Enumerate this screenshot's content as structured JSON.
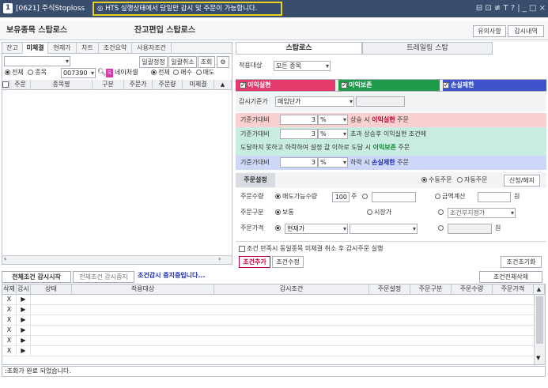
{
  "window": {
    "id_badge": "1",
    "title": "[0621] 주식Stoploss",
    "warning": "◎ HTS 실행상태에서 당일만 감시 및 주문이 가능합니다.",
    "controls": "⊟ ⊡ ≢ T ? | _ □ ×"
  },
  "header": {
    "title_left": "보유종목 스탑로스",
    "title_center": "잔고편입 스탑로스",
    "btn_caution": "유의사항",
    "btn_history": "감시내역"
  },
  "left": {
    "tabs": [
      "잔고",
      "미체결",
      "현재가",
      "차트",
      "조건요약",
      "사용자조건"
    ],
    "account_placeholder": "",
    "btn_bulk_correct": "일괄정정",
    "btn_bulk_cancel": "일괄취소",
    "btn_query": "조회",
    "radio_all": "전체",
    "radio_stock": "종목",
    "stock_code": "007390",
    "stock_name": "네이처셀",
    "radio_all2": "전체",
    "radio_buy": "매수",
    "radio_sell": "매도",
    "columns": [
      "주문",
      "종목명",
      "구분",
      "주문가",
      "주문량",
      "미체결"
    ]
  },
  "right": {
    "tab_stoploss": "스탑로스",
    "tab_trailing": "트레일링 스탑",
    "target_label": "적용대상",
    "target_value": "모든 종목",
    "chk_profit": "이익실현",
    "chk_preserve": "이익보존",
    "chk_loss": "손실제한",
    "basis_label": "감시기준가",
    "basis_value": "매입단가",
    "row1": {
      "label": "기준가대비",
      "value": "3",
      "unit": "%",
      "t1": "상승 시",
      "t2": "이익실현",
      "t3": "주문"
    },
    "row2": {
      "label": "기준가대비",
      "value": "3",
      "unit": "%",
      "t1": "초과 상승후 이익실현 조건에"
    },
    "row2b": {
      "t1": "도달하지 못하고 하락하여 설정 값 이하로 도달 시",
      "t2": "이익보존",
      "t3": "주문"
    },
    "row3": {
      "label": "기준가대비",
      "value": "3",
      "unit": "%",
      "t1": "하락 시",
      "t2": "손실제한",
      "t3": "주문"
    },
    "order_settings": "주문설정",
    "radio_manual": "수동주문",
    "radio_auto": "자동주문",
    "btn_apply": "신청/해지",
    "qty_label": "주문수량",
    "qty_radio1": "매도가능수량",
    "qty_value": "100",
    "qty_unit": "주",
    "amount_label": "금액계산",
    "amount_unit": "원",
    "type_label": "주문구분",
    "type_normal": "보통",
    "type_market": "시장가",
    "type_cond": "조건부지정가",
    "price_label": "주문가격",
    "price_current": "현재가",
    "price_unit": "원",
    "cancel_note": "조건 만족시 동일종목 미체결 취소 후 감시주문 실행",
    "btn_add": "조건추가",
    "btn_edit": "조건수정",
    "btn_reset": "조건초기화"
  },
  "monitor": {
    "btn_start_all": "전체조건 감시시작",
    "btn_stop_all": "전체조건 감시중지",
    "status": "조건감시 중지중입니다...",
    "btn_delete_all": "조건전체삭제",
    "columns": [
      "삭제",
      "감시",
      "상태",
      "적용대상",
      "감시조건",
      "주문설정",
      "주문구분",
      "주문수량",
      "주문가격"
    ],
    "row_delete": "X",
    "row_play": "▶"
  },
  "statusbar": {
    "text": ":조회가 완료 되었습니다."
  },
  "colors": {
    "titlebar": "#394e6c",
    "profit_band": "#f9cfcf",
    "preserve_band": "#c8ecdf",
    "loss_band": "#cdd7f7",
    "profit_text": "#c0003a",
    "preserve_text": "#0a8a32",
    "loss_text": "#1d2fb8"
  }
}
